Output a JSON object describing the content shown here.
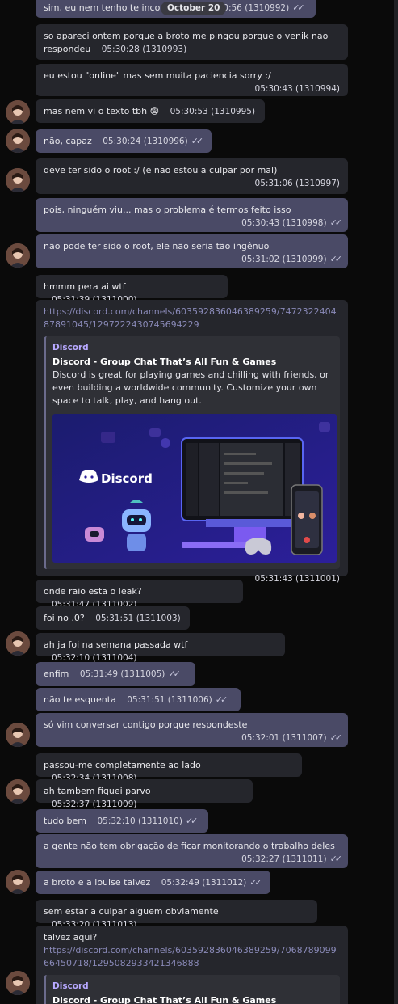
{
  "date_pill": "October 20",
  "messages": [
    {
      "text": "sim, eu nem tenho te incomodado",
      "time": "05:30:56",
      "id": "(1310992)"
    },
    {
      "text": "so apareci ontem porque a broto me pingou porque o venik nao respondeu",
      "time": "05:30:28",
      "id": "(1310993)"
    },
    {
      "text": "eu estou \"online\" mas sem muita paciencia sorry :/",
      "time": "05:30:43",
      "id": "(1310994)"
    },
    {
      "text": "mas nem vi o texto tbh 😨",
      "time": "05:30:53",
      "id": "(1310995)"
    },
    {
      "text": "não, capaz",
      "time": "05:30:24",
      "id": "(1310996)"
    },
    {
      "text": "deve ter sido o root :/ (e nao estou a culpar por mal)",
      "time": "05:31:06",
      "id": "(1310997)"
    },
    {
      "text": "pois, ninguém viu... mas o problema é termos feito isso",
      "time": "05:30:43",
      "id": "(1310998)"
    },
    {
      "text": "não pode ter sido o root, ele não seria tão ingênuo",
      "time": "05:31:02",
      "id": "(1310999)"
    },
    {
      "text": "hmmm pera ai wtf",
      "time": "05:31:39",
      "id": "(1311000)"
    },
    {
      "text": "",
      "time": "05:31:43",
      "id": "(1311001)"
    },
    {
      "text": "onde raio esta o leak?",
      "time": "05:31:47",
      "id": "(1311002)"
    },
    {
      "text": "foi no .0?",
      "time": "05:31:51",
      "id": "(1311003)"
    },
    {
      "text": "ah ja foi na semana passada wtf",
      "time": "05:32:10",
      "id": "(1311004)"
    },
    {
      "text": "enfim",
      "time": "05:31:49",
      "id": "(1311005)"
    },
    {
      "text": "não te esquenta",
      "time": "05:31:51",
      "id": "(1311006)"
    },
    {
      "text": "só vim conversar contigo porque respondeste",
      "time": "05:32:01",
      "id": "(1311007)"
    },
    {
      "text": "passou-me completamente ao lado",
      "time": "05:32:34",
      "id": "(1311008)"
    },
    {
      "text": "ah tambem fiquei parvo",
      "time": "05:32:37",
      "id": "(1311009)"
    },
    {
      "text": "tudo bem",
      "time": "05:32:10",
      "id": "(1311010)"
    },
    {
      "text": "a gente não tem obrigação de ficar monitorando o trabalho deles",
      "time": "05:32:27",
      "id": "(1311011)"
    },
    {
      "text": "a broto e a louise talvez",
      "time": "05:32:49",
      "id": "(1311012)"
    },
    {
      "text": "sem estar a culpar alguem obviamente",
      "time": "05:33:20",
      "id": "(1311013)"
    },
    {
      "text": "talvez aqui?",
      "time": "",
      "id": ""
    }
  ],
  "link1": "https://discord.com/channels/603592836046389259/747232240487891045/1297222430745694229",
  "link2": "https://discord.com/channels/603592836046389259/706878909966450718/1295082933421346888",
  "embed": {
    "site": "Discord",
    "title": "Discord - Group Chat That’s All Fun & Games",
    "description": "Discord is great for playing games and chilling with friends, or even building a worldwide community. Customize your own space to talk, play, and hang out.",
    "image_logo_text": "Discord"
  },
  "ticks": "✓✓",
  "colors": {
    "incoming": "#25262c",
    "outgoing": "#4a4a66",
    "link": "#8a8ab8",
    "embed_site": "#b7a8ff"
  }
}
